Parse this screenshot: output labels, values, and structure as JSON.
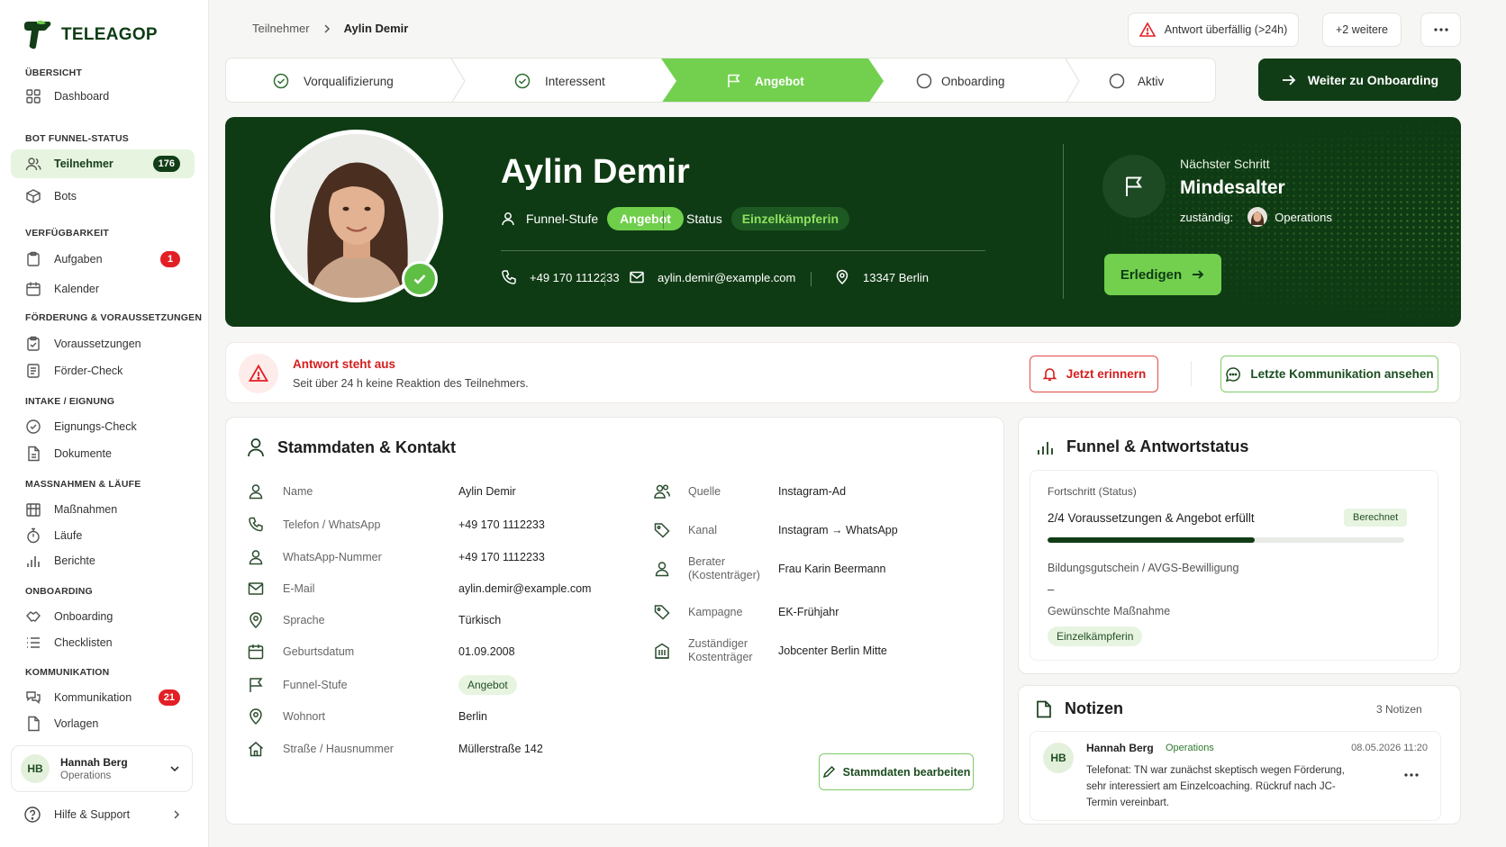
{
  "brand": {
    "name": "TELEAGOP",
    "color": "#113d16",
    "accent": "#72d04e",
    "danger": "#e31f26"
  },
  "sidebar": {
    "sections": [
      {
        "title": "ÜBERSICHT"
      },
      {
        "title": "BOT FUNNEL-STATUS"
      },
      {
        "title": "VERFÜGBARKEIT"
      },
      {
        "title": "FÖRDERUNG & VORAUSSETZUNGEN"
      },
      {
        "title": "INTAKE / EIGNUNG"
      },
      {
        "title": "MASSNAHMEN & LÄUFE"
      },
      {
        "title": "ONBOARDING"
      },
      {
        "title": "KOMMUNIKATION"
      }
    ],
    "items": [
      {
        "label": "Dashboard",
        "icon": "grid-icon"
      },
      {
        "label": "Teilnehmer",
        "icon": "users-icon",
        "badge": "176",
        "active": true
      },
      {
        "label": "Bots",
        "icon": "cube-icon"
      },
      {
        "label": "Aufgaben",
        "icon": "clipboard-icon",
        "badge": "1"
      },
      {
        "label": "Kalender",
        "icon": "calendar-icon"
      },
      {
        "label": "Voraussetzungen",
        "icon": "clipboard-check-icon"
      },
      {
        "label": "Förder-Check",
        "icon": "checklist-icon"
      },
      {
        "label": "Eignungs-Check",
        "icon": "check-circle-icon"
      },
      {
        "label": "Dokumente",
        "icon": "document-icon"
      },
      {
        "label": "Maßnahmen",
        "icon": "building-icon"
      },
      {
        "label": "Läufe",
        "icon": "stopwatch-icon"
      },
      {
        "label": "Berichte",
        "icon": "bar-chart-icon"
      },
      {
        "label": "Onboarding",
        "icon": "handshake-icon"
      },
      {
        "label": "Checklisten",
        "icon": "list-icon"
      },
      {
        "label": "Kommunikation",
        "icon": "chat-icon",
        "badge": "21"
      },
      {
        "label": "Vorlagen",
        "icon": "template-icon"
      }
    ],
    "user": {
      "initials": "HB",
      "name": "Hannah Berg",
      "role": "Operations"
    },
    "help": "Hilfe & Support"
  },
  "breadcrumb": {
    "parent": "Teilnehmer",
    "current": "Aylin Demir"
  },
  "topbar": {
    "alert": "Antwort überfällig (>24h)",
    "more": "+2 weitere",
    "menu_icon": "more-horizontal-icon"
  },
  "stepper": {
    "steps": [
      {
        "label": "Vorqualifizierung",
        "state": "done"
      },
      {
        "label": "Interessent",
        "state": "done"
      },
      {
        "label": "Angebot",
        "state": "current"
      },
      {
        "label": "Onboarding",
        "state": "todo"
      },
      {
        "label": "Aktiv",
        "state": "todo"
      }
    ],
    "cta": "Weiter zu Onboarding"
  },
  "hero": {
    "name": "Aylin Demir",
    "funnel_label": "Funnel-Stufe",
    "funnel_value": "Angebot",
    "status_label": "Status",
    "status_value": "Einzelkämpferin",
    "phone": "+49 170 1112233",
    "email": "aylin.demir@example.com",
    "location": "13347 Berlin",
    "next_label": "Nächster Schritt",
    "next_value": "Mindesalter",
    "owner_label": "zuständig:",
    "owner_value": "Operations",
    "action": "Erledigen"
  },
  "alert": {
    "title": "Antwort steht aus",
    "text": "Seit über 24 h keine Reaktion des Teilnehmers.",
    "remind": "Jetzt erinnern",
    "view": "Letzte Kommunikation ansehen"
  },
  "master": {
    "title": "Stammdaten & Kontakt",
    "left": [
      {
        "label": "Name",
        "value": "Aylin Demir",
        "icon": "user-icon"
      },
      {
        "label": "Telefon / WhatsApp",
        "value": "+49 170 1112233",
        "icon": "phone-icon"
      },
      {
        "label": "WhatsApp-Nummer",
        "value": "+49 170 1112233",
        "icon": "user-icon"
      },
      {
        "label": "E-Mail",
        "value": "aylin.demir@example.com",
        "icon": "mail-icon"
      },
      {
        "label": "Sprache",
        "value": "Türkisch",
        "icon": "pin-icon"
      },
      {
        "label": "Geburtsdatum",
        "value": "01.09.2008",
        "icon": "calendar-icon"
      },
      {
        "label": "Funnel-Stufe",
        "value": "Angebot",
        "icon": "flag-icon"
      },
      {
        "label": "Wohnort",
        "value": "Berlin",
        "icon": "pin-icon"
      },
      {
        "label": "Straße / Hausnummer",
        "value": "Müllerstraße 142",
        "icon": "home-icon"
      }
    ],
    "right": [
      {
        "label": "Quelle",
        "value": "Instagram-Ad",
        "icon": "users-icon"
      },
      {
        "label": "Kanal",
        "value": "Instagram → WhatsApp",
        "icon": "tag-icon"
      },
      {
        "label": "Berater (Kostenträger)",
        "value": "Frau Karin Beermann",
        "icon": "user-icon"
      },
      {
        "label": "Kampagne",
        "value": "EK-Frühjahr",
        "icon": "tag-icon"
      },
      {
        "label": "Zuständiger Kostenträger",
        "value": "Jobcenter Berlin Mitte",
        "icon": "building-icon"
      }
    ],
    "edit": "Stammdaten bearbeiten"
  },
  "funnel": {
    "title": "Funnel & Antwortstatus",
    "progress_label": "Fortschritt (Status)",
    "progress_text": "2/4 Voraussetzungen & Angebot erfüllt",
    "progress_badge": "Berechnet",
    "progress": 0.58,
    "voucher_label": "Bildungsgutschein / AVGS-Bewilligung",
    "voucher_value": "–",
    "measure_label": "Gewünschte Maßnahme",
    "measure_value": "Einzelkämpferin"
  },
  "notes": {
    "title": "Notizen",
    "count": "3 Notizen",
    "items": [
      {
        "initials": "HB",
        "author": "Hannah Berg",
        "role": "Operations",
        "date": "08.05.2026 11:20",
        "text": "Telefonat: TN war zunächst skeptisch wegen Förderung, sehr interessiert am Einzelcoaching. Rückruf nach JC-Termin vereinbart."
      }
    ]
  }
}
